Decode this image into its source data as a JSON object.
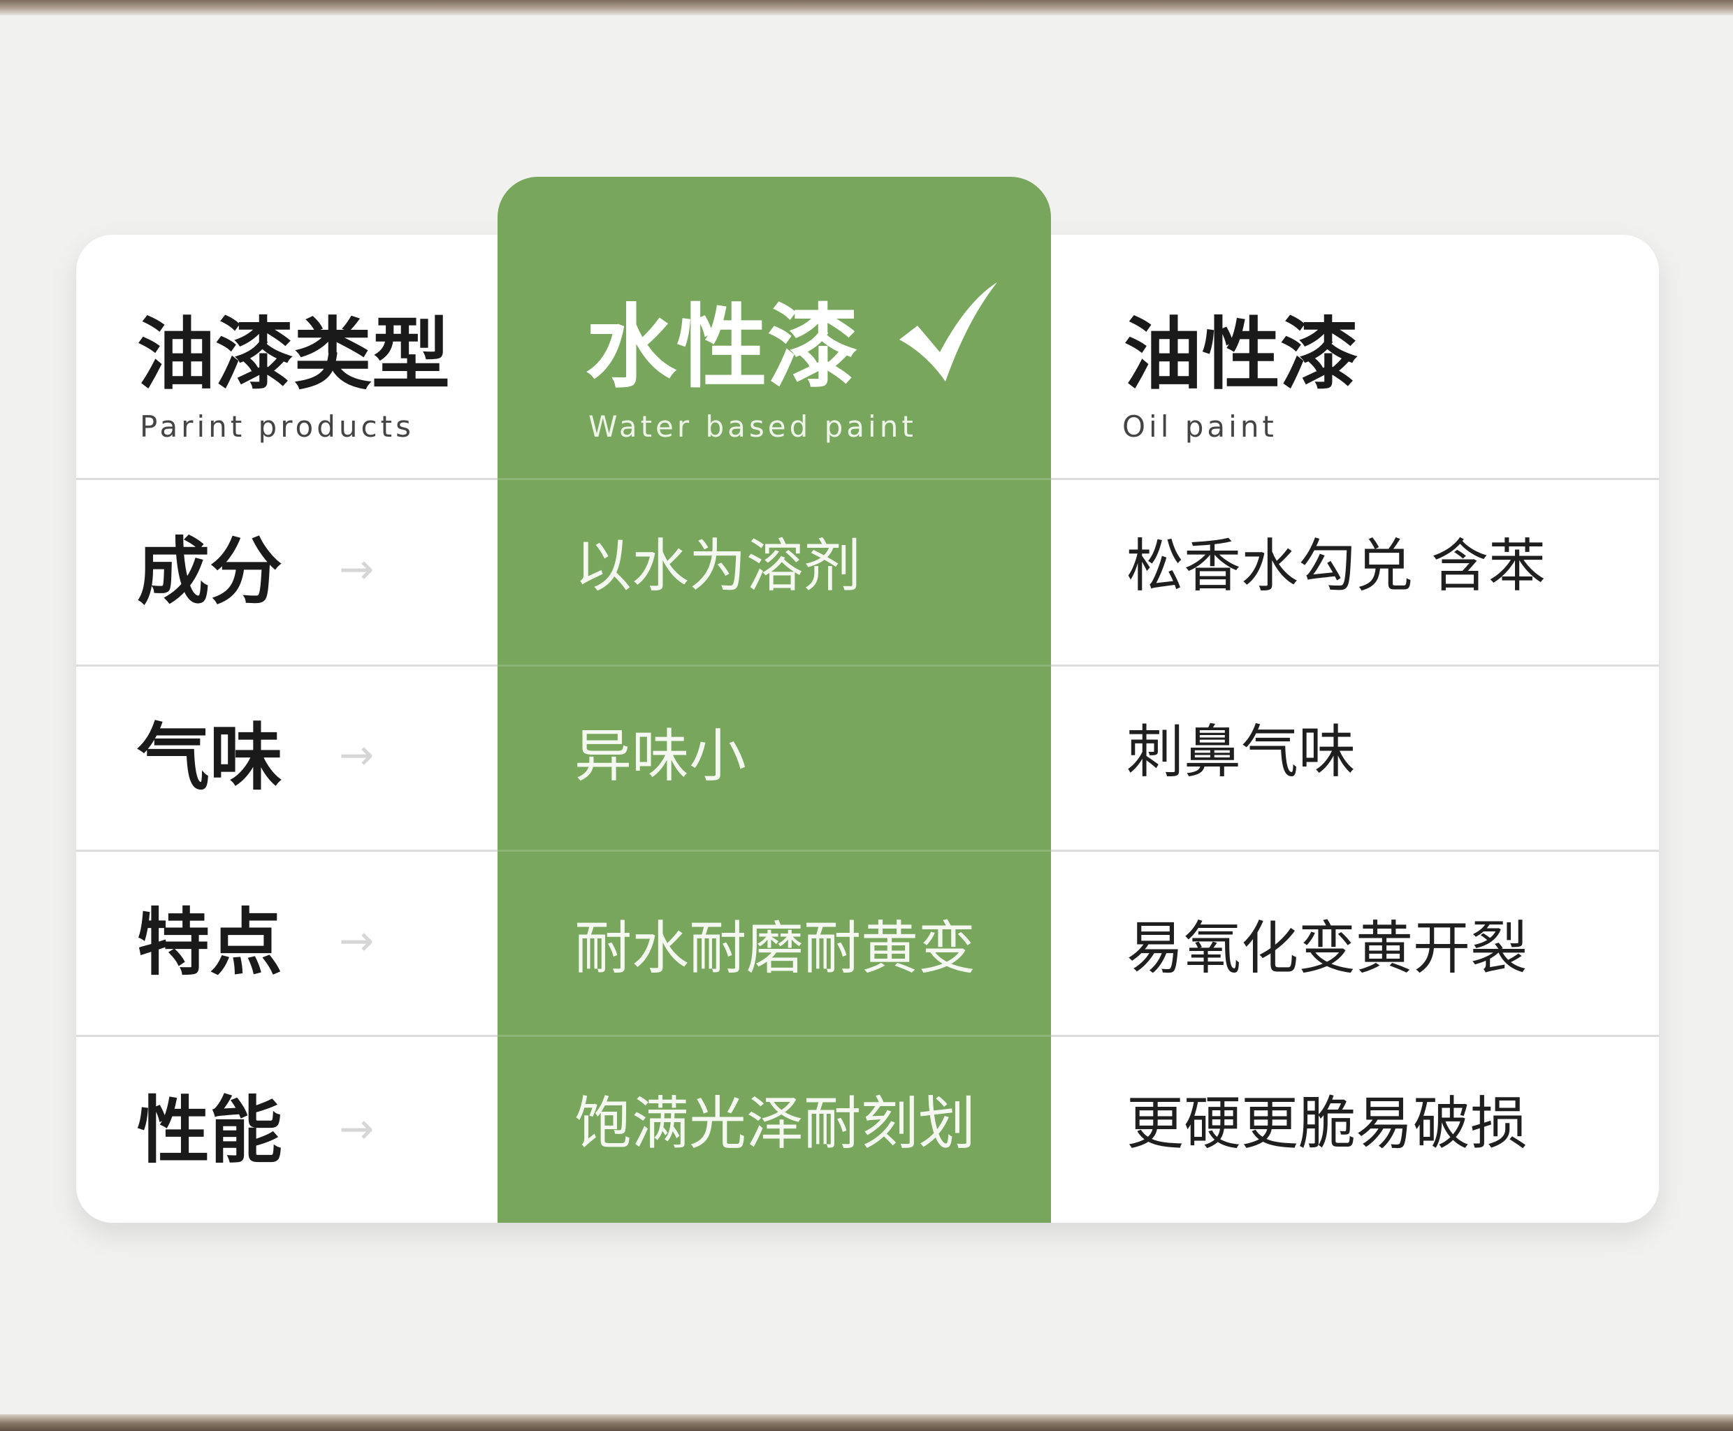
{
  "header": {
    "type_zh": "油漆类型",
    "type_en": "Parint products",
    "water_zh": "水性漆",
    "water_en": "Water based paint",
    "oil_zh": "油性漆",
    "oil_en": "Oil paint"
  },
  "arrow_glyph": "→",
  "rows": [
    {
      "label": "成分",
      "water": "以水为溶剂",
      "oil": "松香水勾兑 含苯"
    },
    {
      "label": "气味",
      "water": "异味小",
      "oil": "刺鼻气味"
    },
    {
      "label": "特点",
      "water": "耐水耐磨耐黄变",
      "oil": "易氧化变黄开裂"
    },
    {
      "label": "性能",
      "water": "饱满光泽耐刻划",
      "oil": "更硬更脆易破损"
    }
  ],
  "colors": {
    "accent_green": "#78a65d",
    "card_bg": "#ffffff",
    "page_bg": "#f1f1ef"
  },
  "icons": {
    "highlight": "checkmark-icon",
    "row_pointer": "arrow-right-icon"
  }
}
